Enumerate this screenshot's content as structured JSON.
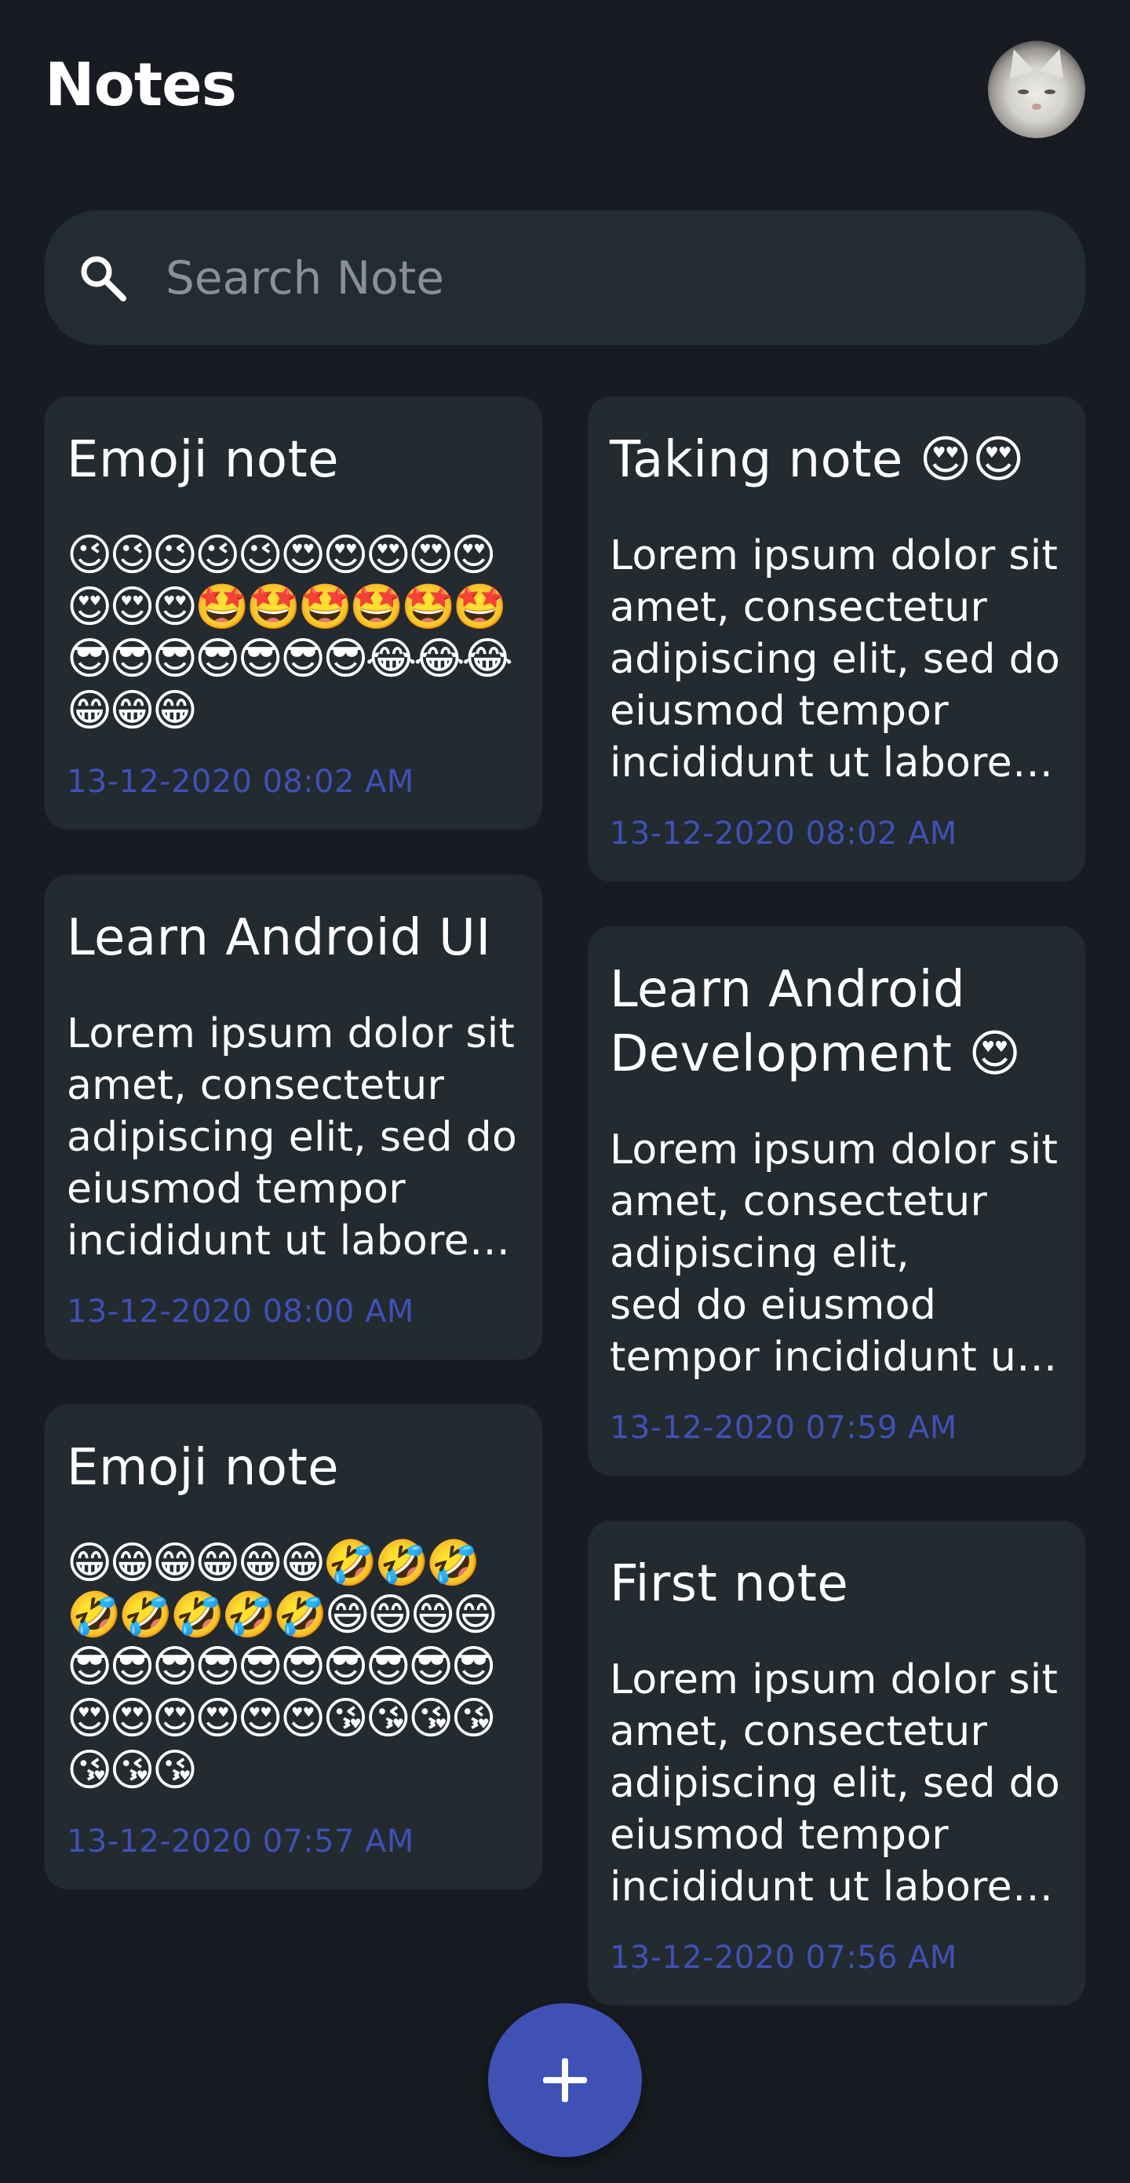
{
  "header": {
    "title": "Notes"
  },
  "search": {
    "placeholder": "Search Note"
  },
  "notes_left": [
    {
      "title": "Emoji note",
      "body": "😉😉😉😉😉😍😍😍😍😍😍😍😍🤩🤩🤩🤩🤩🤩😎😎😎😎😎😎😎😂😂😂😁😁😁",
      "date": "13-12-2020 08:02 AM"
    },
    {
      "title": "Learn Android UI",
      "body": "Lorem ipsum dolor sit amet, consectetur adipiscing elit, sed do eiusmod tempor incididunt ut labore et dolore magna aliqua.",
      "date": "13-12-2020 08:00 AM"
    },
    {
      "title": "Emoji note",
      "body": "😁😁😁😁😁😁🤣🤣🤣🤣🤣🤣🤣🤣😄😄😄😄😎😎😎😎😎😎😎😎😎😎😍😍😍😍😍😍😘😘😘😘😘😘😘",
      "date": "13-12-2020 07:57 AM"
    }
  ],
  "notes_right": [
    {
      "title": "Taking note 😍😍",
      "body": "Lorem ipsum dolor sit amet, consectetur adipiscing elit, sed do eiusmod tempor incididunt ut labore et dolore magna aliqua.",
      "date": "13-12-2020 08:02 AM"
    },
    {
      "title": "Learn Android Development 😍",
      "body": "Lorem ipsum dolor sit amet, consectetur adipiscing elit,\nsed do eiusmod tempor incididunt ut labore et dolore magna aliqua.",
      "date": "13-12-2020 07:59 AM"
    },
    {
      "title": "First note",
      "body": "Lorem ipsum dolor sit amet, consectetur adipiscing elit, sed do eiusmod tempor incididunt ut labore et dolore magna aliqua.",
      "date": "13-12-2020 07:56 AM"
    }
  ],
  "fab": {
    "icon": "plus-icon"
  },
  "colors": {
    "background": "#181c22",
    "card": "#232a30",
    "search_bg": "#242c33",
    "accent": "#3f51b5",
    "text": "#ffffff"
  }
}
